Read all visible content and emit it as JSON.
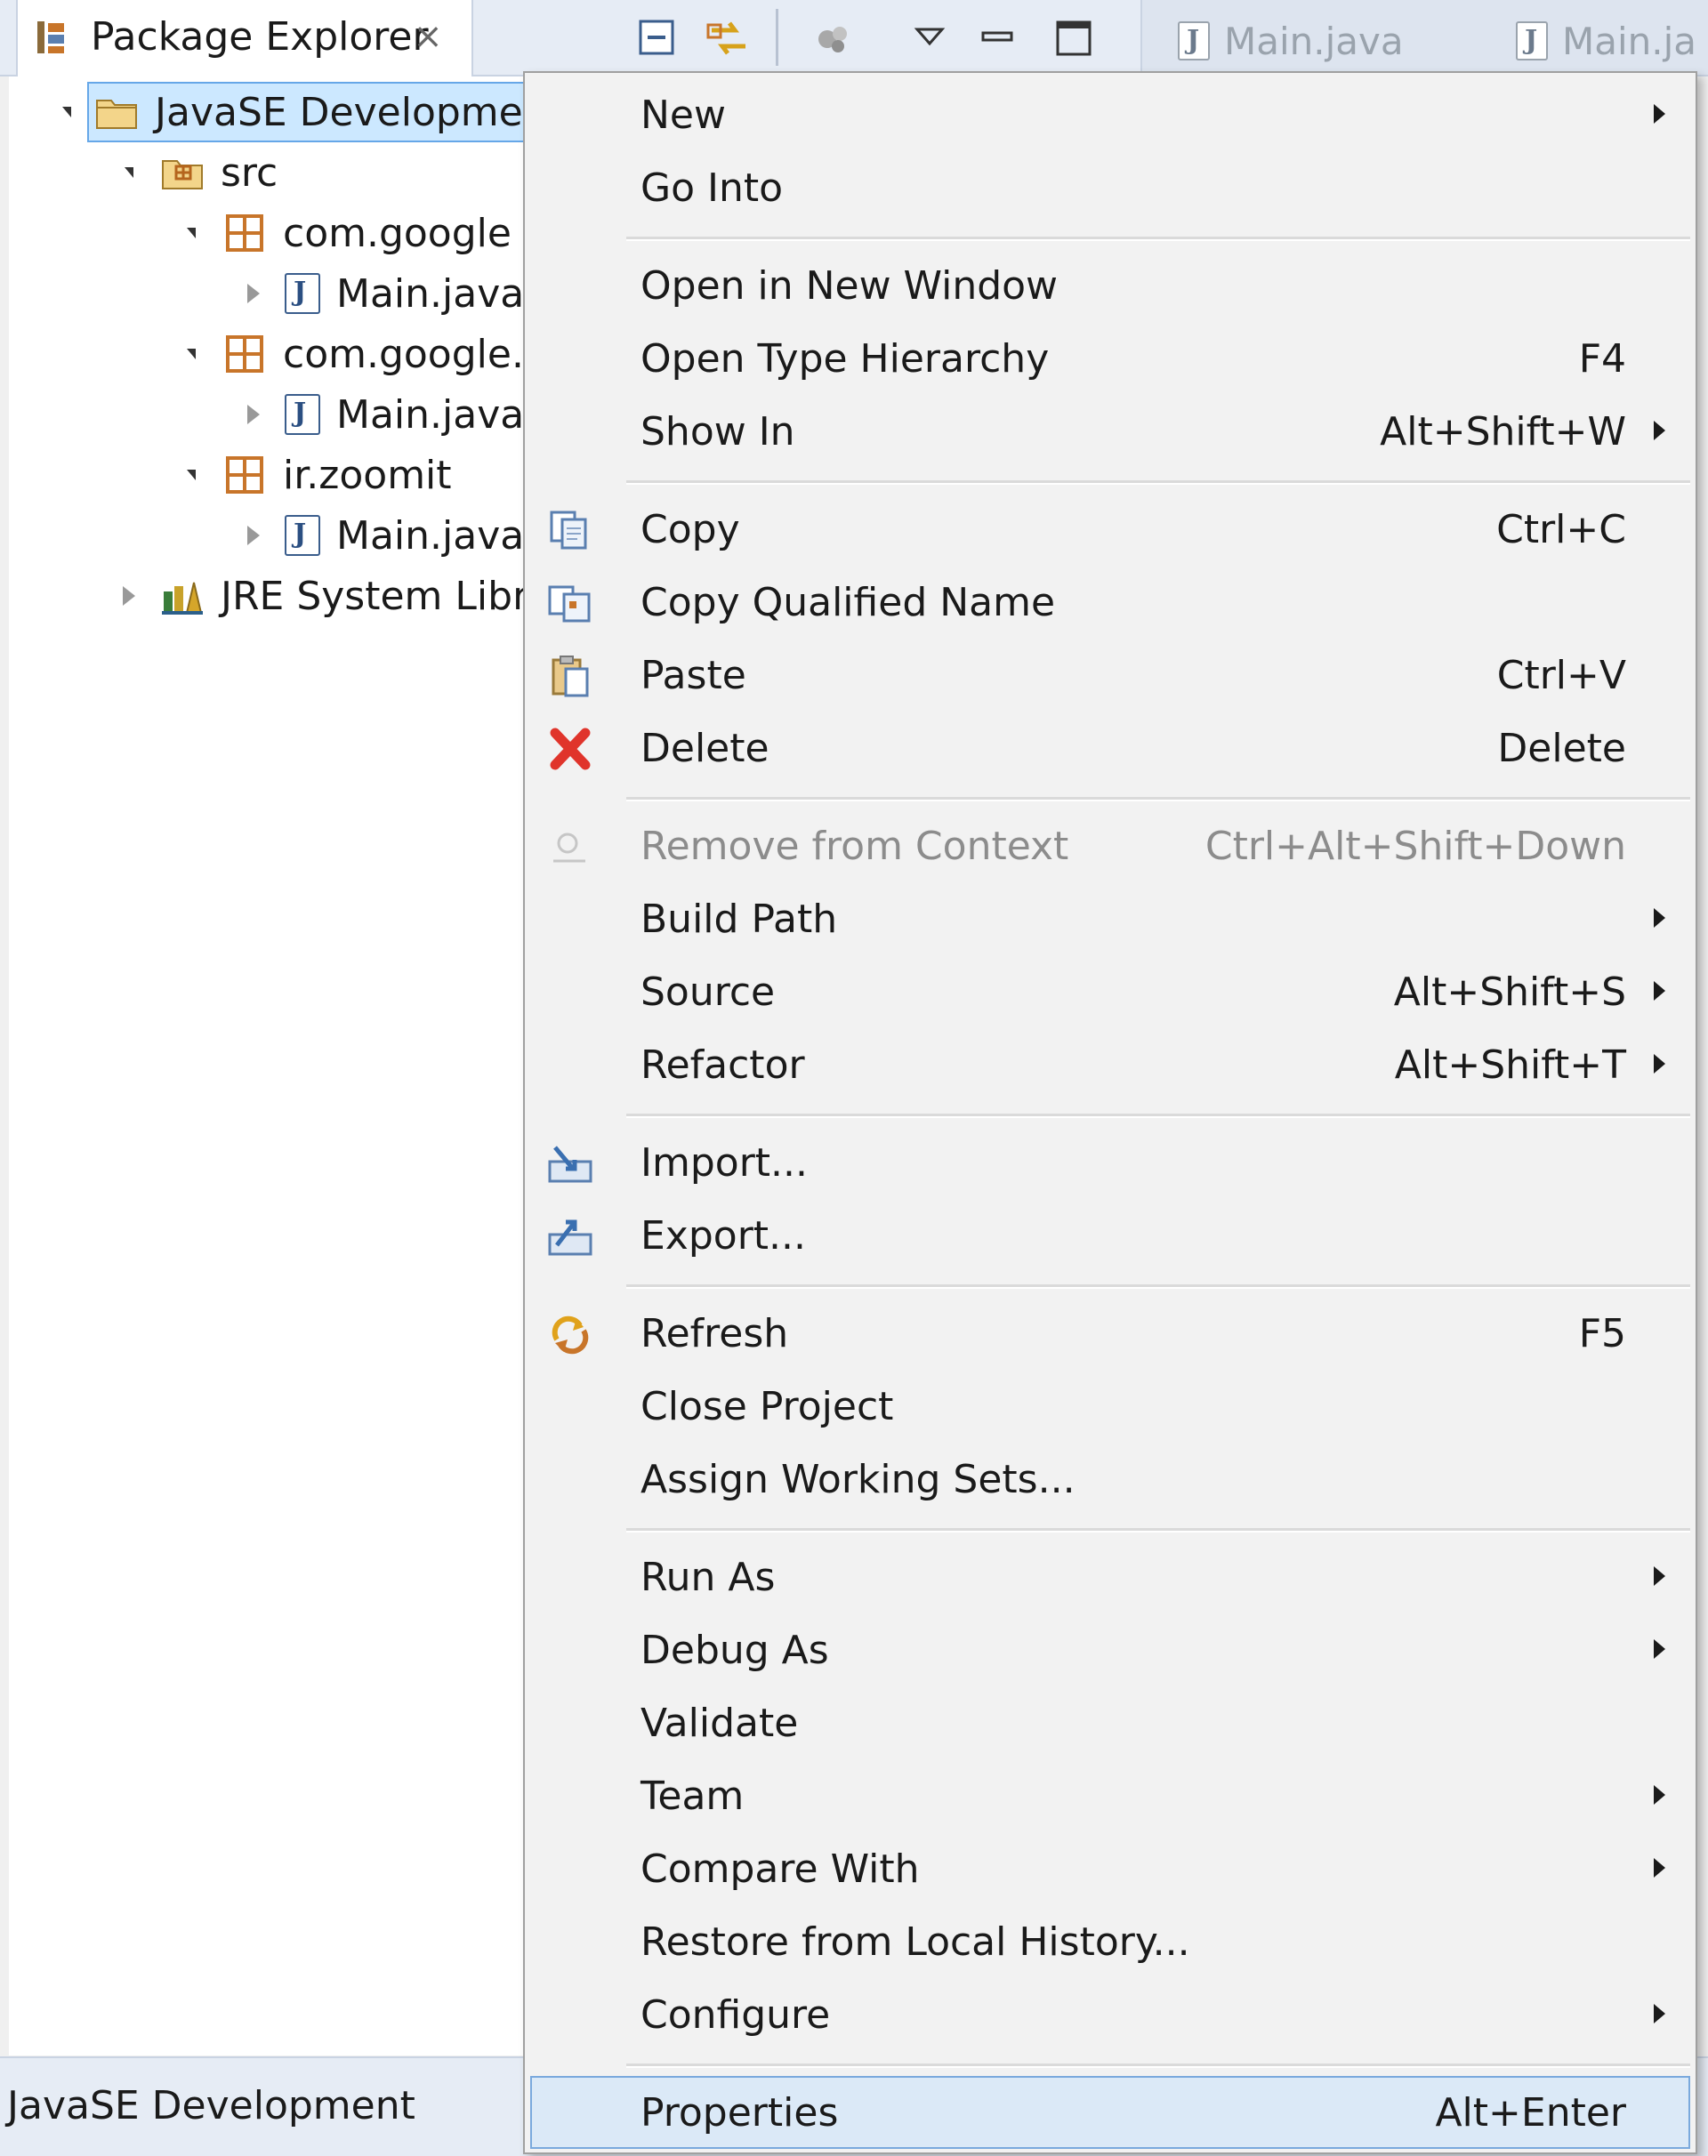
{
  "view_tab": {
    "title": "Package Explorer",
    "close_glyph": "⨯"
  },
  "editor_tabs": [
    {
      "label": "Main.java"
    },
    {
      "label": "Main.ja"
    }
  ],
  "tree": {
    "project": "JavaSE Development",
    "src": "src",
    "pkg1": "com.google",
    "pkg1_file": "Main.java",
    "pkg2": "com.google.j",
    "pkg2_file": "Main.java",
    "pkg3": "ir.zoomit",
    "pkg3_file": "Main.java",
    "jre": "JRE System Librar"
  },
  "status": {
    "text": "JavaSE Development"
  },
  "menu": {
    "new": "New",
    "go_into": "Go Into",
    "open_new_window": "Open in New Window",
    "open_type_hierarchy": "Open Type Hierarchy",
    "open_type_hierarchy_sc": "F4",
    "show_in": "Show In",
    "show_in_sc": "Alt+Shift+W",
    "copy": "Copy",
    "copy_sc": "Ctrl+C",
    "copy_qualified": "Copy Qualified Name",
    "paste": "Paste",
    "paste_sc": "Ctrl+V",
    "delete": "Delete",
    "delete_sc": "Delete",
    "remove_context": "Remove from Context",
    "remove_context_sc": "Ctrl+Alt+Shift+Down",
    "build_path": "Build Path",
    "source": "Source",
    "source_sc": "Alt+Shift+S",
    "refactor": "Refactor",
    "refactor_sc": "Alt+Shift+T",
    "import": "Import...",
    "export": "Export...",
    "refresh": "Refresh",
    "refresh_sc": "F5",
    "close_project": "Close Project",
    "assign_working_sets": "Assign Working Sets...",
    "run_as": "Run As",
    "debug_as": "Debug As",
    "validate": "Validate",
    "team": "Team",
    "compare_with": "Compare With",
    "restore_history": "Restore from Local History...",
    "configure": "Configure",
    "properties": "Properties",
    "properties_sc": "Alt+Enter"
  },
  "icons": {
    "package_explorer": "package-explorer-icon",
    "collapse_all": "collapse-all-icon",
    "link_editor": "link-with-editor-icon",
    "view_menu": "view-menu-icon",
    "minimize": "minimize-icon",
    "maximize": "maximize-icon"
  },
  "colors": {
    "selection": "#cce8ff",
    "delete_icon": "#e0342b",
    "package_icon": "#c8752a"
  }
}
